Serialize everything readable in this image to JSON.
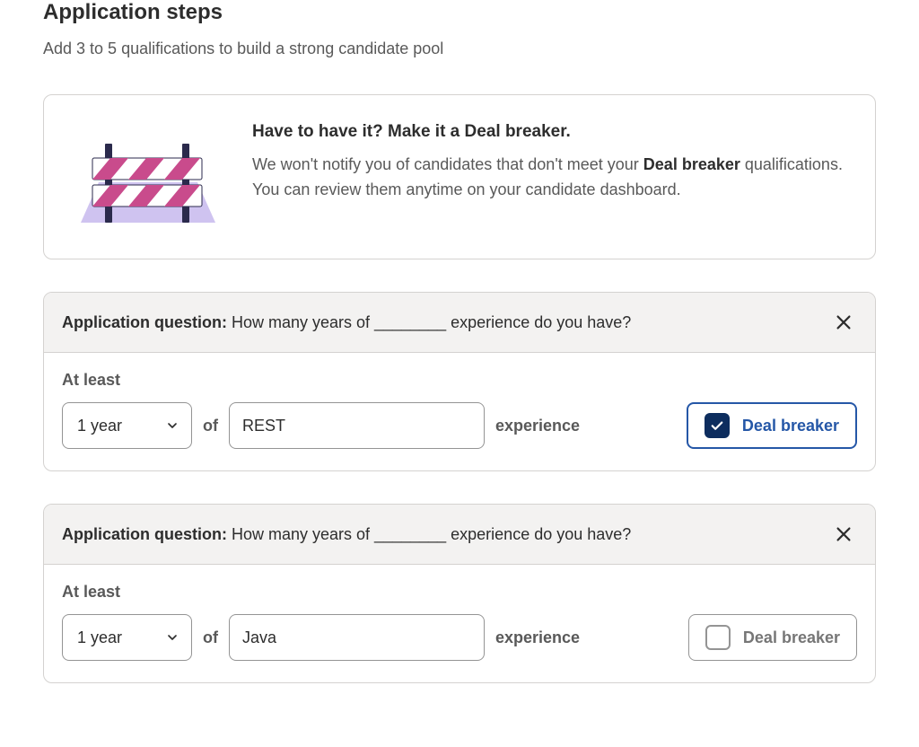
{
  "header": {
    "title": "Application steps",
    "subtitle": "Add 3 to 5 qualifications to build a strong candidate pool"
  },
  "info": {
    "heading": "Have to have it? Make it a Deal breaker.",
    "body_pre": "We won't notify you of candidates that don't meet your ",
    "body_bold": "Deal breaker",
    "body_post": " qualifications. You can review them anytime on your candidate dashboard."
  },
  "questions": [
    {
      "label_prefix": "Application question:",
      "label_text": " How many years of ________ experience do you have?",
      "at_least": "At least",
      "duration": "1 year",
      "of": "of",
      "skill": "REST",
      "experience": "experience",
      "deal_label": "Deal breaker",
      "deal_breaker": true
    },
    {
      "label_prefix": "Application question:",
      "label_text": " How many years of ________ experience do you have?",
      "at_least": "At least",
      "duration": "1 year",
      "of": "of",
      "skill": "Java",
      "experience": "experience",
      "deal_label": "Deal breaker",
      "deal_breaker": false
    }
  ]
}
